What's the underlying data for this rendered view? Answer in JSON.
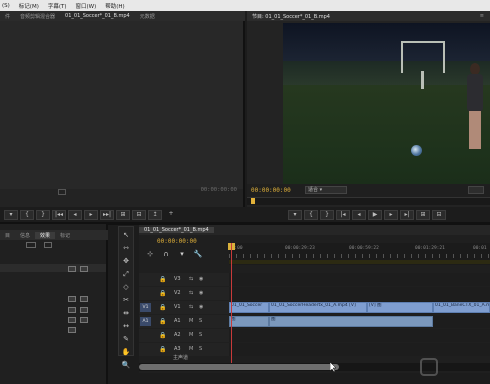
{
  "menu": [
    "(S)",
    "标记(M)",
    "字幕(T)",
    "窗口(W)",
    "帮助(H)"
  ],
  "source_panel": {
    "tabs": [
      "件",
      "音频剪辑混合器",
      "01_01_Soccer*_01_B.mp4",
      "元数据"
    ],
    "timecode": "00:00:00:00",
    "controls": [
      "▾",
      "|",
      "{",
      "}",
      "|◂◂",
      "◂",
      "▸",
      "▸▸|",
      "⊞",
      "⊟",
      "↥",
      "+"
    ]
  },
  "program_panel": {
    "tab": "节目: 01_01_Soccer*_01_B.mp4",
    "timecode": "00:00:00:00",
    "fit": "适合",
    "controls": [
      "▾",
      "{",
      "}",
      "|◂",
      "◂",
      "▶",
      "▸",
      "▸|",
      "⊞",
      "⊟"
    ]
  },
  "project_panel": {
    "tabs": [
      "目",
      "信息",
      "效果",
      "标记"
    ]
  },
  "tools": [
    "↖",
    "⇿",
    "✥",
    "⤢",
    "◇",
    "✂",
    "⇹",
    "↔",
    "✎",
    "✋",
    "🔍"
  ],
  "timeline": {
    "tab": "01_01_Soccer*_01_B.mp4",
    "timecode": "00:00:00:00",
    "ruler_labels": [
      "00:00",
      "00:00:29:23",
      "00:00:59:22",
      "00:01:29:21",
      "00:01"
    ],
    "master_label": "主声道",
    "tracks": [
      {
        "name": "V3",
        "type": "video"
      },
      {
        "name": "V2",
        "type": "video"
      },
      {
        "name": "V1",
        "type": "video",
        "src": "V1"
      },
      {
        "name": "A1",
        "type": "audio",
        "src": "A1"
      },
      {
        "name": "A2",
        "type": "audio"
      },
      {
        "name": "A3",
        "type": "audio"
      }
    ],
    "video_clips": [
      "01_01_Soccer",
      "01_01_SoccerHeadertx_01_A.mp4 [V]",
      "[V] 图",
      "01_01_BaneCTX_01_A.mp4"
    ],
    "audio_clips": [
      "图",
      "图"
    ]
  }
}
